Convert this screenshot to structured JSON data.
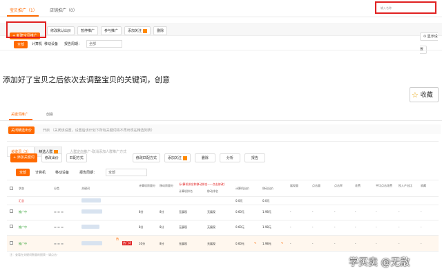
{
  "top": {
    "tab_active": "宝贝推广（1）",
    "tab_other": "店铺推广（0）",
    "search_placeholder": "输入名称",
    "toolbar": {
      "new_product_button": "+ 新建宝贝推广",
      "btn1": "修改默认出价",
      "btn2": "暂停推广",
      "btn3": "参与推广",
      "btn4": "添加关注",
      "btn5": "删除",
      "right_label": "显示设置"
    },
    "filter": {
      "chip": "全部",
      "device1": "计算机",
      "device2": "移动设备",
      "period_label": "报告周期：",
      "period_value": "全部"
    }
  },
  "article": {
    "text": "添加好了宝贝之后依次去调整宝贝的关键词，创意",
    "collect_label": "收藏"
  },
  "bottom": {
    "tab_active": "关键词推广",
    "tab_other": "创意",
    "batch_button": "关闭精选出价",
    "batch_hint": "开启 （关闭该设置，设置后该计划下所有关键词将不再出现在精选列表）",
    "subtab1": "关键词（3）",
    "subtab2": "精选人群",
    "subtab_hint": "人群定向推广-取消添加人群推广方式",
    "buttons": {
      "add_keyword": "+ 添加关键词",
      "modify_bid": "修改出价",
      "match_mode": "匹配方式",
      "quality": "修改匹配方式",
      "follow": "添加关注",
      "delete": "删除",
      "report": "分析",
      "hint": "报告"
    },
    "filter": {
      "chip": "全部",
      "device1": "计算机",
      "device2": "移动设备",
      "period_label": "报告周期：",
      "period_value": "全部"
    },
    "headers": [
      "状态",
      "分类",
      "关键词",
      "计算机质量分",
      "移动质量分",
      "计算机出价",
      "移动出价",
      "计算机排名",
      "移动排名",
      "展现量",
      "点击量",
      "点击率",
      "花费",
      "平均点击花费",
      "投入产出比",
      "收藏"
    ],
    "header_red_note": "(计算机排名和移动排名-----点击修改)",
    "summary_row": {
      "label": "汇总",
      "v1": "0.0元",
      "v2": "0.0元"
    },
    "rows": [
      {
        "status": "推广中",
        "pc_score": "8分",
        "m_score": "8分",
        "pc_rank": "无展现",
        "m_rank": "无展现",
        "pc_bid": "0.60元",
        "m_bid": "1.98元",
        "dash": "-"
      },
      {
        "status": "推广中",
        "pc_score": "8分",
        "m_score": "8分",
        "pc_rank": "无展现",
        "m_rank": "无展现",
        "pc_bid": "0.60元",
        "m_bid": "1.98元",
        "dash": "-"
      },
      {
        "status": "推广中",
        "pc_score": "10分",
        "m_score": "8分",
        "pc_rank": "无展现",
        "m_rank": "无展现",
        "pc_bid": "0.60元",
        "m_bid": "1.98元",
        "dash": "-",
        "badge1": "热",
        "badge2": "热门词"
      }
    ],
    "footer_note": "注：查看在关键词数量的报表 - 请点击-"
  },
  "watermark": "学买卖 @无敌",
  "colors": {
    "accent": "#ff6a00",
    "frame_red": "#e02020",
    "status_green": "#2a9d2a"
  }
}
